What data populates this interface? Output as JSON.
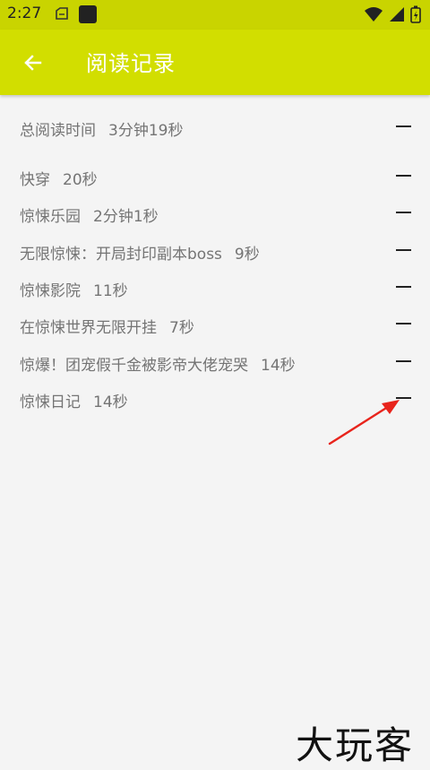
{
  "status_bar": {
    "time": "2:27"
  },
  "app_bar": {
    "title": "阅读记录"
  },
  "records": {
    "total": {
      "label": "总阅读时间",
      "time": "3分钟19秒"
    },
    "items": [
      {
        "title": "快穿",
        "time": "20秒"
      },
      {
        "title": "惊悚乐园",
        "time": "2分钟1秒"
      },
      {
        "title": "无限惊悚：开局封印副本boss",
        "time": "9秒"
      },
      {
        "title": "惊悚影院",
        "time": "11秒"
      },
      {
        "title": "在惊悚世界无限开挂",
        "time": "7秒"
      },
      {
        "title": "惊爆！团宠假千金被影帝大佬宠哭",
        "time": "14秒"
      },
      {
        "title": "惊悚日记",
        "time": "14秒"
      }
    ]
  },
  "watermark": {
    "text": "大玩客"
  },
  "colors": {
    "status_bar": "#c9d400",
    "app_bar": "#d2de00",
    "background": "#f4f4f4",
    "annotation_arrow": "#e8241c"
  }
}
